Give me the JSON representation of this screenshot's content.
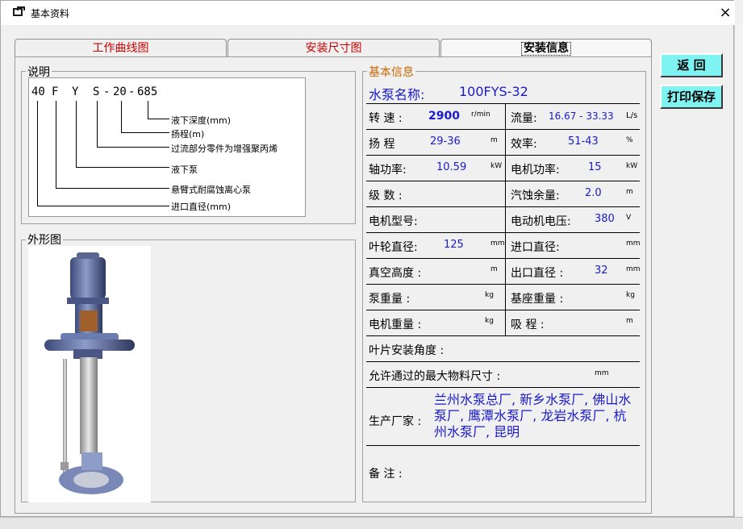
{
  "window": {
    "title": "基本资料",
    "close_glyph": "×"
  },
  "tabs": [
    "工作曲线图",
    "安装尺寸图",
    "安装信息"
  ],
  "buttons": {
    "back": "返 回",
    "print_save": "打印保存"
  },
  "explanation": {
    "legend": "说明",
    "code_parts": [
      "40",
      "F",
      "Y",
      "S",
      "-",
      "20",
      "-",
      "685"
    ],
    "notes": [
      "液下深度(mm)",
      "扬程(m)",
      "过流部分零件为增强聚丙烯",
      "液下泵",
      "悬臂式耐腐蚀离心泵",
      "进口直径(mm)"
    ]
  },
  "appearance": {
    "legend": "外形图"
  },
  "info": {
    "legend": "基本信息",
    "pump_name_label": "水泵名称:",
    "pump_name_value": "100FYS-32",
    "speed": {
      "label": "转 速 :",
      "value": "2900",
      "unit": "r/min"
    },
    "flow": {
      "label": "流量:",
      "value": "16.67 - 33.33",
      "unit": "L/s"
    },
    "head": {
      "label": "扬 程",
      "value": "29-36",
      "unit": "m"
    },
    "efficiency": {
      "label": "效率:",
      "value": "51-43",
      "unit": "%"
    },
    "shaft_power": {
      "label": "轴功率:",
      "value": "10.59",
      "unit": "kW"
    },
    "motor_power": {
      "label": "电机功率:",
      "value": "15",
      "unit": "kW"
    },
    "stages": {
      "label": "级 数 :"
    },
    "npsh": {
      "label": "汽蚀余量:",
      "value": "2.0",
      "unit": "m"
    },
    "motor_model": {
      "label": "电机型号:"
    },
    "motor_voltage": {
      "label": "电动机电压:",
      "value": "380",
      "unit": "V"
    },
    "impeller_dia": {
      "label": "叶轮直径:",
      "value": "125",
      "unit": "mm"
    },
    "inlet_dia": {
      "label": "进口直径:",
      "unit": "mm"
    },
    "vacuum_height": {
      "label": "真空高度 :",
      "unit": "m"
    },
    "outlet_dia": {
      "label": "出口直径 :",
      "value": "32",
      "unit": "mm"
    },
    "pump_weight": {
      "label": "泵重量 :",
      "unit": "kg"
    },
    "base_weight": {
      "label": "基座重量 :",
      "unit": "kg"
    },
    "motor_weight": {
      "label": "电机重量 :",
      "unit": "kg"
    },
    "suction": {
      "label": "吸 程 :",
      "unit": "m"
    },
    "blade_angle": {
      "label": "叶片安装角度 :"
    },
    "max_particle": {
      "label": "允许通过的最大物料尺寸 :",
      "unit": "mm"
    },
    "manufacturer": {
      "label": "生产厂家 :",
      "value": "兰州水泵总厂, 新乡水泵厂, 佛山水泵厂, 鹰潭水泵厂, 龙岩水泵厂, 杭州水泵厂, 昆明"
    },
    "remarks": {
      "label": "备 注 :"
    }
  },
  "colors": {
    "tab_text": "#cc0000",
    "value_text": "#1a1acc",
    "button_bg": "#7ff2f2",
    "legend_orange": "#cc6600"
  }
}
